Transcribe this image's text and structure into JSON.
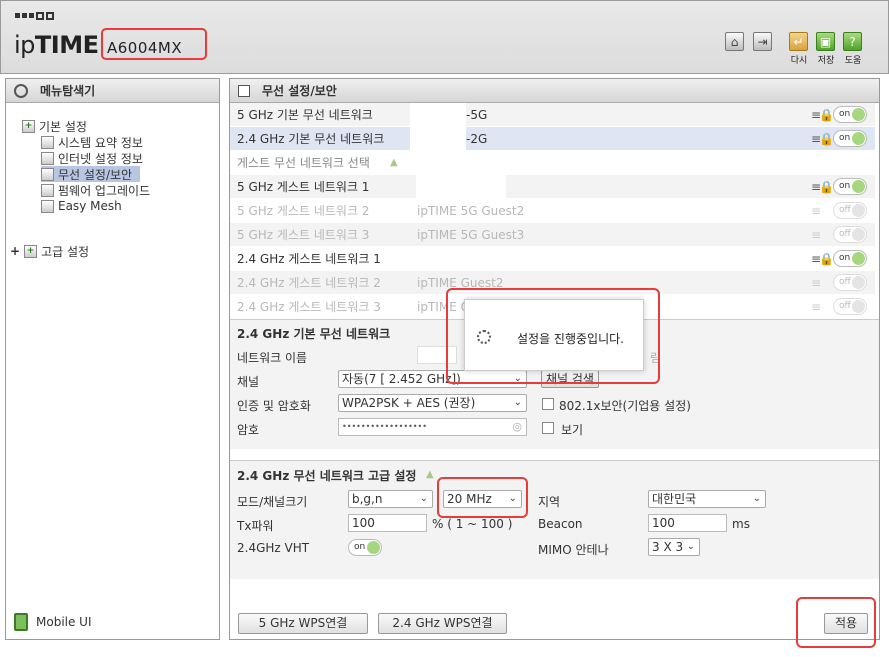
{
  "header": {
    "brand_light": "ip",
    "brand_bold": "TIME",
    "model": "A6004MX",
    "buttons": [
      {
        "name": "home-icon",
        "label": ""
      },
      {
        "name": "logout-icon",
        "label": ""
      },
      {
        "name": "restart-icon",
        "label": "다시"
      },
      {
        "name": "save-icon",
        "label": "저장"
      },
      {
        "name": "help-icon",
        "label": "도움"
      }
    ]
  },
  "left": {
    "title": "메뉴탐색기",
    "tree": {
      "basic": "기본 설정",
      "items": [
        "시스템 요약 정보",
        "인터넷 설정 정보",
        "무선 설정/보안",
        "펌웨어 업그레이드",
        "Easy Mesh"
      ],
      "advanced": "고급 설정"
    },
    "mobile_ui": "Mobile UI"
  },
  "right": {
    "title": "무선 설정/보안",
    "networks": [
      {
        "name": "5 GHz 기본 무선 네트워크",
        "ssid": "-5G",
        "on": "on",
        "enabled": true
      },
      {
        "name": "2.4 GHz 기본 무선 네트워크",
        "ssid": "-2G",
        "on": "on",
        "enabled": true
      },
      {
        "name": "게스트 무선 네트워크 선택",
        "ssid": "",
        "on": "",
        "enabled": true
      },
      {
        "name": "5 GHz 게스트 네트워크 1",
        "ssid": "",
        "on": "on",
        "enabled": true
      },
      {
        "name": "5 GHz 게스트 네트워크 2",
        "ssid": "ipTIME 5G Guest2",
        "on": "off",
        "enabled": false
      },
      {
        "name": "5 GHz 게스트 네트워크 3",
        "ssid": "ipTIME 5G Guest3",
        "on": "off",
        "enabled": false
      },
      {
        "name": "2.4 GHz 게스트 네트워크 1",
        "ssid": "",
        "on": "on",
        "enabled": true
      },
      {
        "name": "2.4 GHz 게스트 네트워크 2",
        "ssid": "ipTIME Guest2",
        "on": "off",
        "enabled": false
      },
      {
        "name": "2.4 GHz 게스트 네트워크 3",
        "ssid": "ipTIME G",
        "on": "off",
        "enabled": false
      }
    ],
    "basic_section": {
      "title": "2.4 GHz 기본 무선 네트워크",
      "network_name_label": "네트워크 이름",
      "hide_label": "림",
      "channel_label": "채널",
      "channel_value": "자동(7 [ 2.452 GHz])",
      "channel_search": "채널 검색",
      "auth_label": "인증 및 암호화",
      "auth_value": "WPA2PSK + AES (권장)",
      "enterprise_label": "802.1x보안(기업용 설정)",
      "password_label": "암호",
      "password_value": "••••••••••••••••••",
      "show_label": "보기"
    },
    "advanced_section": {
      "title": "2.4 GHz 무선 네트워크 고급 설정",
      "mode_label": "모드/채널크기",
      "mode_value": "b,g,n",
      "width_value": "20 MHz",
      "region_label": "지역",
      "region_value": "대한민국",
      "tx_label": "Tx파워",
      "tx_value": "100",
      "tx_unit": "% ( 1 ~ 100 )",
      "beacon_label": "Beacon",
      "beacon_value": "100",
      "beacon_unit": "ms",
      "vht_label": "2.4GHz VHT",
      "vht_toggle": "on",
      "mimo_label": "MIMO 안테나",
      "mimo_value": "3 X 3"
    },
    "buttons": {
      "wps5": "5 GHz WPS연결",
      "wps24": "2.4 GHz WPS연결",
      "apply": "적용"
    }
  },
  "modal": {
    "message": "설정을 진행중입니다."
  }
}
